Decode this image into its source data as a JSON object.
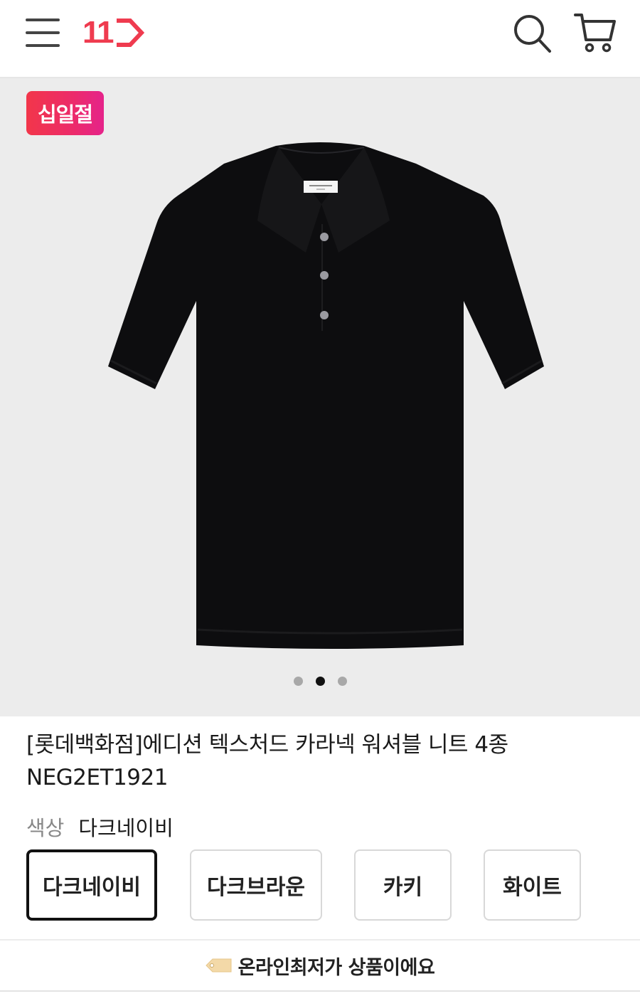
{
  "header": {
    "logo_text": "11",
    "menu_icon": "hamburger-menu-icon",
    "search_icon": "search-icon",
    "cart_icon": "shopping-cart-icon",
    "brand_color": "#ef3b4f"
  },
  "gallery": {
    "badge": "십일절",
    "image_subject": "black-short-sleeve-polo-knit",
    "total_slides": 3,
    "active_slide": 2
  },
  "product": {
    "title_line1": "[롯데백화점]에디션 텍스처드 카라넥 워셔블 니트 4종",
    "title_line2": "NEG2ET1921",
    "color_label": "색상",
    "color_value": "다크네이비",
    "color_options": [
      "다크네이비",
      "다크브라운",
      "카키",
      "화이트"
    ],
    "selected_option": "다크네이비"
  },
  "footer": {
    "message": "온라인최저가 상품이에요",
    "icon": "price-tag-icon"
  }
}
